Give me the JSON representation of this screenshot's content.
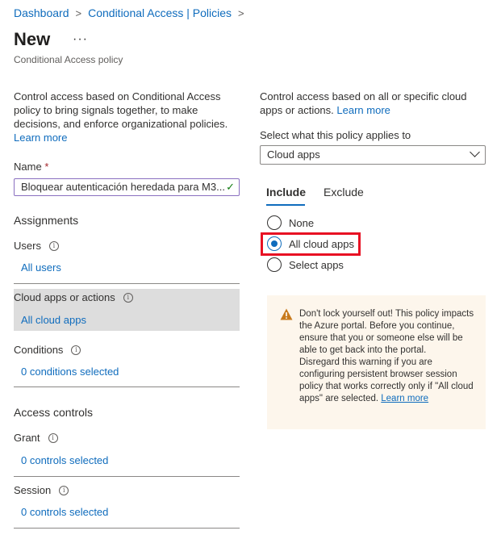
{
  "breadcrumb": {
    "items": [
      "Dashboard",
      "Conditional Access | Policies"
    ]
  },
  "header": {
    "title": "New",
    "more_label": "···",
    "subtitle": "Conditional Access policy"
  },
  "left": {
    "description": "Control access based on Conditional Access policy to bring signals together, to make decisions, and enforce organizational policies.",
    "learn_more": "Learn more",
    "name_label": "Name",
    "required_mark": "*",
    "name_value": "Bloquear autenticación heredada para M3...",
    "assignments_heading": "Assignments",
    "users_label": "Users",
    "users_value": "All users",
    "cloud_apps_label": "Cloud apps or actions",
    "cloud_apps_value": "All cloud apps",
    "conditions_label": "Conditions",
    "conditions_value": "0 conditions selected",
    "access_controls_heading": "Access controls",
    "grant_label": "Grant",
    "grant_value": "0 controls selected",
    "session_label": "Session",
    "session_value": "0 controls selected"
  },
  "right": {
    "description": "Control access based on all or specific cloud apps or actions.",
    "learn_more": "Learn more",
    "applies_label": "Select what this policy applies to",
    "applies_value": "Cloud apps",
    "tabs": [
      "Include",
      "Exclude"
    ],
    "active_tab": "Include",
    "radio_options": [
      "None",
      "All cloud apps",
      "Select apps"
    ],
    "selected_option": "All cloud apps",
    "warning": {
      "line1": "Don't lock yourself out! This policy impacts the Azure portal. Before you continue, ensure that you or someone else will be able to get back into the portal.",
      "line2": "Disregard this warning if you are configuring persistent browser session policy that works correctly only if \"All cloud apps\" are selected.",
      "learn_more": "Learn more"
    }
  },
  "colors": {
    "link": "#0f6cbd",
    "highlight": "#e81123",
    "warning_bg": "#fdf6ec",
    "warning_icon": "#c87a1c",
    "selected_row_bg": "#dddddd"
  }
}
